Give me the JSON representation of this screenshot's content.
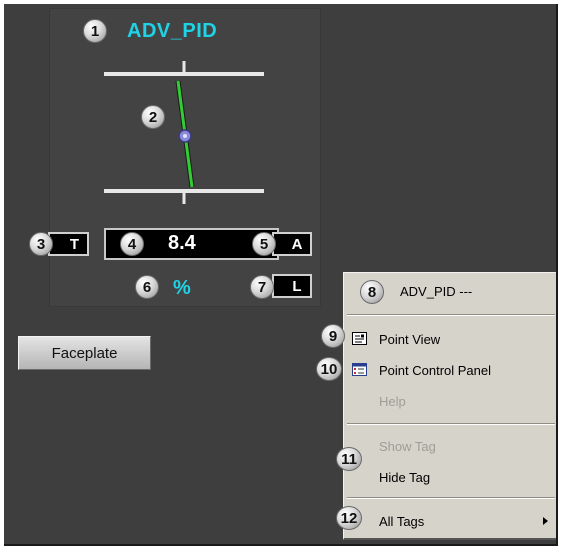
{
  "faceplate": {
    "tag_name": "ADV_PID",
    "pv_value": "8.4",
    "units": "%",
    "tracking_button": "T",
    "mode_button": "A",
    "local_button": "L",
    "faceplate_button": "Faceplate"
  },
  "context_menu": {
    "header": "ADV_PID ---",
    "items": [
      {
        "label": "Point View",
        "enabled": true,
        "icon": "point-view-icon"
      },
      {
        "label": "Point Control Panel",
        "enabled": true,
        "icon": "point-control-panel-icon"
      },
      {
        "label": "Help",
        "enabled": false
      },
      {
        "label": "Show Tag",
        "enabled": false
      },
      {
        "label": "Hide Tag",
        "enabled": true
      },
      {
        "label": "All Tags",
        "enabled": true,
        "submenu": true
      }
    ]
  },
  "callouts": [
    "1",
    "2",
    "3",
    "4",
    "5",
    "6",
    "7",
    "8",
    "9",
    "10",
    "11",
    "12"
  ],
  "colors": {
    "background": "#3e3e3e",
    "accent_cyan": "#1fd3e6",
    "needle_green": "#33cc33",
    "menu_bg": "#d6d3cb"
  }
}
